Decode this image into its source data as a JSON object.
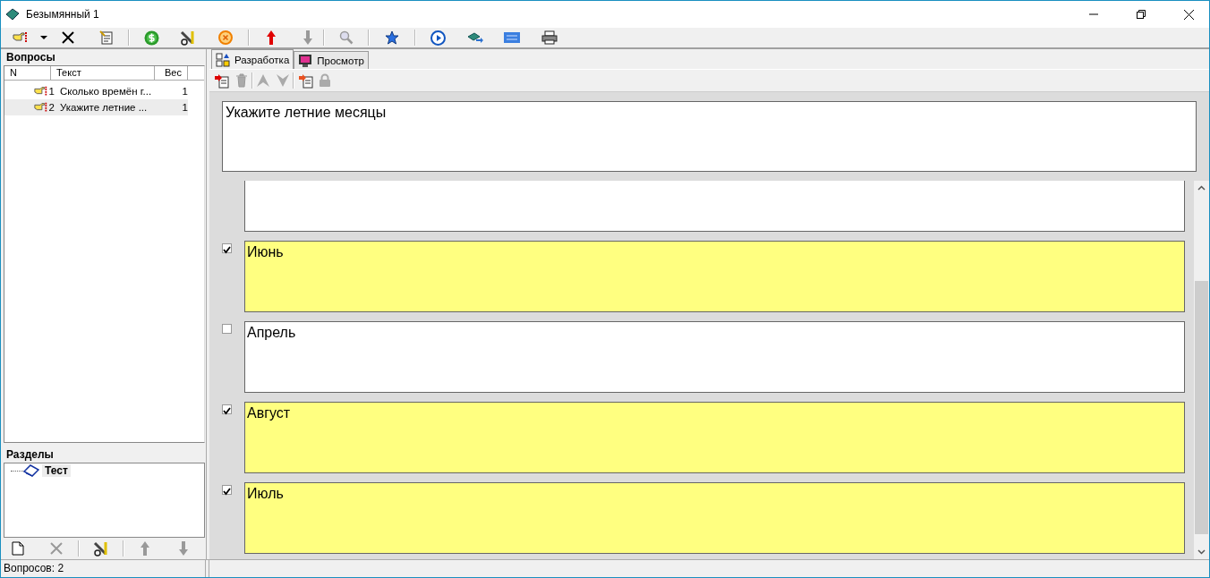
{
  "window": {
    "title": "Безымянный 1"
  },
  "questions_panel": {
    "title": "Вопросы",
    "columns": [
      "N",
      "Текст",
      "Вес"
    ],
    "rows": [
      {
        "n": "1",
        "text": "Сколько времён г...",
        "weight": "1",
        "selected": false
      },
      {
        "n": "2",
        "text": "Укажите летние ...",
        "weight": "1",
        "selected": true
      }
    ]
  },
  "sections_panel": {
    "title": "Разделы",
    "items": [
      {
        "label": "Тест",
        "selected": true
      }
    ]
  },
  "status_bar": {
    "text": "Вопросов: 2"
  },
  "tabs": [
    {
      "label": "Разработка",
      "selected": true
    },
    {
      "label": "Просмотр",
      "selected": false
    }
  ],
  "question": {
    "text": "Укажите летние месяцы"
  },
  "answers": [
    {
      "text": "Июнь",
      "checked": true
    },
    {
      "text": "Апрель",
      "checked": false
    },
    {
      "text": "Август",
      "checked": true
    },
    {
      "text": "Июль",
      "checked": true
    }
  ]
}
